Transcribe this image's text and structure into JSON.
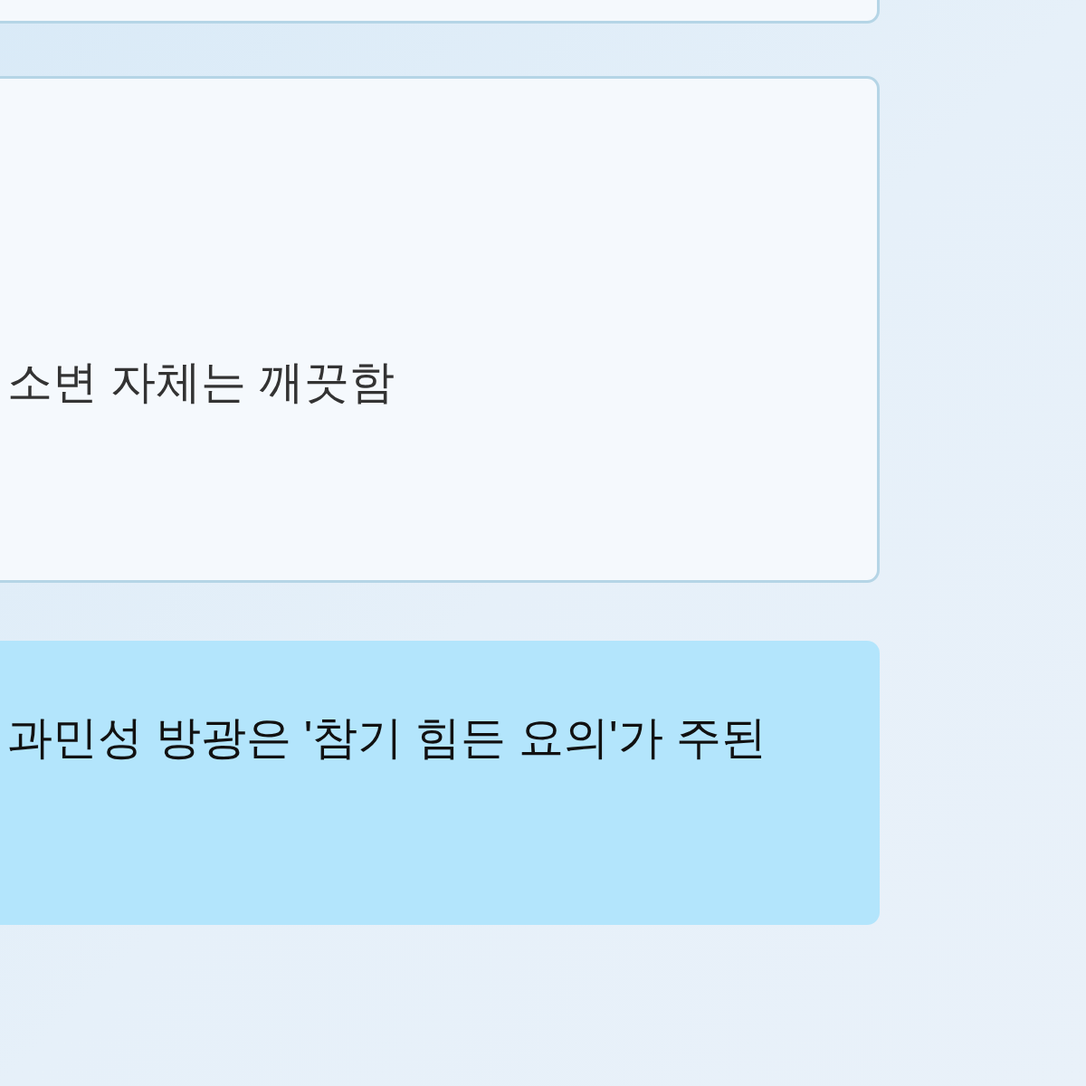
{
  "options": [
    {
      "selected": false
    },
    {
      "text": "소변 자체는 깨끗함",
      "selected": false
    },
    {
      "text": "과민성 방광은 '참기 힘든 요의'가 주된",
      "selected": true
    }
  ]
}
